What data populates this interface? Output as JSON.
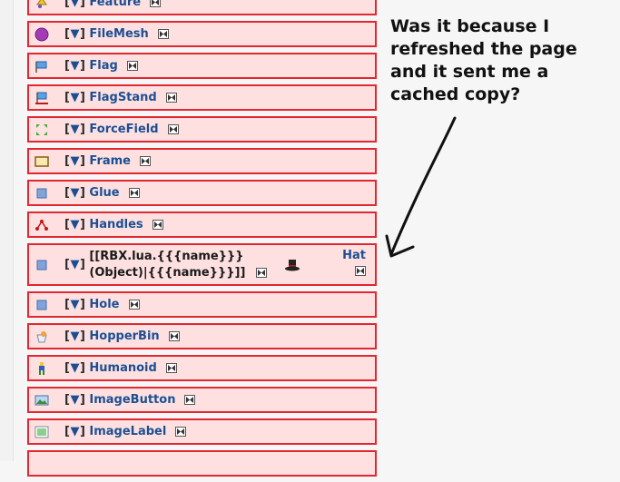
{
  "toggle": {
    "open": "[",
    "tri": "▼",
    "close": "]"
  },
  "rows": [
    {
      "name": "Feature",
      "icon": "feature-icon"
    },
    {
      "name": "FileMesh",
      "icon": "filemesh-icon"
    },
    {
      "name": "Flag",
      "icon": "flag-icon"
    },
    {
      "name": "FlagStand",
      "icon": "flagstand-icon"
    },
    {
      "name": "ForceField",
      "icon": "forcefield-icon"
    },
    {
      "name": "Frame",
      "icon": "frame-icon"
    },
    {
      "name": "Glue",
      "icon": "glue-icon"
    },
    {
      "name": "Handles",
      "icon": "handles-icon"
    }
  ],
  "broken_row": {
    "line1": "[[RBX.lua.{{{name}}}",
    "line2": "(Object)|{{{name}}}]]",
    "hat_label": "Hat",
    "icon": "box-icon",
    "hat_icon": "top-hat-icon"
  },
  "rows2": [
    {
      "name": "Hole",
      "icon": "hole-icon"
    },
    {
      "name": "HopperBin",
      "icon": "hopperbin-icon"
    },
    {
      "name": "Humanoid",
      "icon": "humanoid-icon"
    },
    {
      "name": "ImageButton",
      "icon": "imagebutton-icon"
    },
    {
      "name": "ImageLabel",
      "icon": "imagelabel-icon"
    }
  ],
  "note": {
    "line1": "Was it because I",
    "line2": "refreshed the page",
    "line3": "and it sent me a",
    "line4": "cached copy?"
  }
}
